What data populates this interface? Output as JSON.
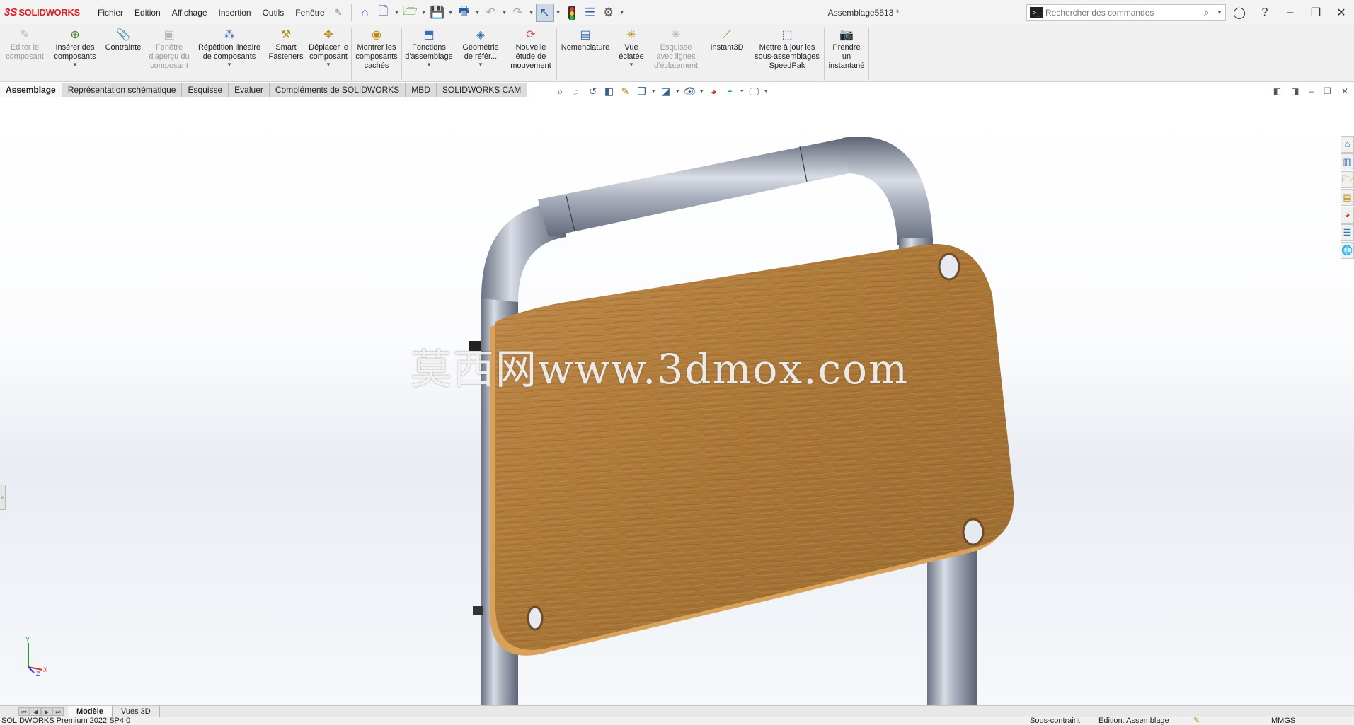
{
  "app": {
    "brand_mark": "3S",
    "brand_name": "SOLIDWORKS"
  },
  "menu": {
    "items": [
      "Fichier",
      "Edition",
      "Affichage",
      "Insertion",
      "Outils",
      "Fenêtre"
    ]
  },
  "document_title": "Assemblage5513 *",
  "search": {
    "placeholder": "Rechercher des commandes"
  },
  "ribbon": {
    "buttons": [
      {
        "label": "Editer le composant",
        "icon": "edit-component-icon",
        "enabled": false,
        "dropdown": false
      },
      {
        "label": "Insérer des composants",
        "icon": "insert-components-icon",
        "enabled": true,
        "dropdown": true
      },
      {
        "label": "Contrainte",
        "icon": "mate-icon",
        "enabled": true,
        "dropdown": false
      },
      {
        "label": "Fenêtre d'aperçu du composant",
        "icon": "preview-window-icon",
        "enabled": false,
        "dropdown": false
      },
      {
        "label": "Répétition linéaire de composants",
        "icon": "linear-pattern-icon",
        "enabled": true,
        "dropdown": true
      },
      {
        "label": "Smart Fasteners",
        "icon": "smart-fasteners-icon",
        "enabled": true,
        "dropdown": false
      },
      {
        "label": "Déplacer le composant",
        "icon": "move-component-icon",
        "enabled": true,
        "dropdown": true
      },
      {
        "label": "Montrer les composants cachés",
        "icon": "show-hidden-icon",
        "enabled": true,
        "dropdown": false
      },
      {
        "label": "Fonctions d'assemblage",
        "icon": "assembly-features-icon",
        "enabled": true,
        "dropdown": true
      },
      {
        "label": "Géométrie de référ...",
        "icon": "reference-geometry-icon",
        "enabled": true,
        "dropdown": true
      },
      {
        "label": "Nouvelle étude de mouvement",
        "icon": "motion-study-icon",
        "enabled": true,
        "dropdown": false
      },
      {
        "label": "Nomenclature",
        "icon": "bom-icon",
        "enabled": true,
        "dropdown": false
      },
      {
        "label": "Vue éclatée",
        "icon": "exploded-view-icon",
        "enabled": true,
        "dropdown": true
      },
      {
        "label": "Esquisse avec lignes d'éclatement",
        "icon": "explode-line-sketch-icon",
        "enabled": false,
        "dropdown": false
      },
      {
        "label": "Instant3D",
        "icon": "instant3d-icon",
        "enabled": true,
        "dropdown": false
      },
      {
        "label": "Mettre à jour les sous-assemblages SpeedPak",
        "icon": "speedpak-icon",
        "enabled": true,
        "dropdown": false
      },
      {
        "label": "Prendre un instantané",
        "icon": "snapshot-icon",
        "enabled": true,
        "dropdown": false
      }
    ]
  },
  "tabs": [
    {
      "label": "Assemblage",
      "active": true
    },
    {
      "label": "Représentation schématique",
      "active": false
    },
    {
      "label": "Esquisse",
      "active": false
    },
    {
      "label": "Evaluer",
      "active": false
    },
    {
      "label": "Compléments de SOLIDWORKS",
      "active": false
    },
    {
      "label": "MBD",
      "active": false
    },
    {
      "label": "SOLIDWORKS CAM",
      "active": false
    }
  ],
  "viewport": {
    "watermark": "莫西网www.3dmox.com",
    "triad_labels": {
      "x": "X",
      "y": "Y",
      "z": "Z"
    }
  },
  "bottom_tabs": [
    {
      "label": "Modèle",
      "active": true
    },
    {
      "label": "Vues 3D",
      "active": false
    }
  ],
  "status": {
    "version": "SOLIDWORKS Premium 2022 SP4.0",
    "constraint": "Sous-contraint",
    "mode": "Edition: Assemblage",
    "units": "MMGS"
  },
  "colors": {
    "brand": "#d2232a",
    "wood": "#b07a3a",
    "tube": "#8e95a5",
    "accent": "#3a6fb0"
  }
}
